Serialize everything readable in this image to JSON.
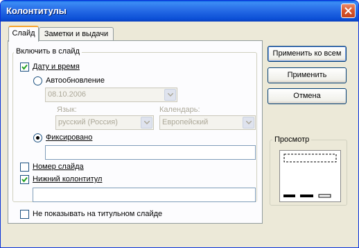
{
  "window": {
    "title": "Колонтитулы"
  },
  "tabs": [
    {
      "label": "Слайд"
    },
    {
      "label": "Заметки и выдачи"
    }
  ],
  "include_group": {
    "label": "Включить в слайд"
  },
  "date_time": {
    "label": "Дату и время",
    "checked": true,
    "autoupdate_label": "Автообновление",
    "autoupdate_value": "08.10.2006",
    "language_label": "Язык:",
    "language_value": "русский (Россия)",
    "calendar_label": "Календарь:",
    "calendar_value": "Европейский",
    "fixed_label": "Фиксировано",
    "fixed_value": ""
  },
  "slide_number": {
    "label": "Номер слайда",
    "checked": false
  },
  "footer": {
    "label": "Нижний колонтитул",
    "checked": true,
    "value": ""
  },
  "hide_on_title": {
    "label": "Не показывать на титульном слайде",
    "checked": false
  },
  "buttons": {
    "apply_all": "Применить ко всем",
    "apply": "Применить",
    "cancel": "Отмена"
  },
  "preview": {
    "label": "Просмотр"
  },
  "colors": {
    "titlebar": "#0a5fe0",
    "dialog_bg": "#ece9d8",
    "close": "#d8542a"
  }
}
